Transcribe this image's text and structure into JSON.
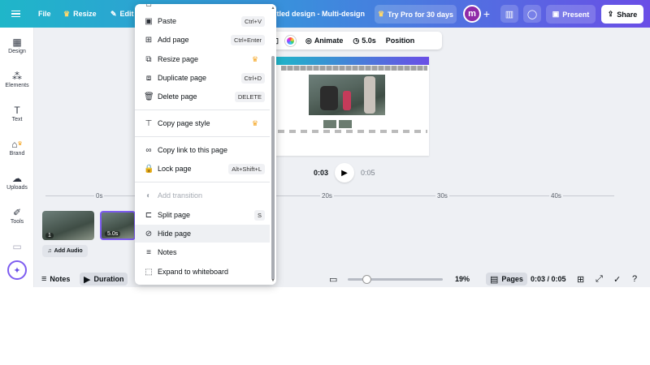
{
  "topbar": {
    "file": "File",
    "resize": "Resize",
    "edit": "Edit",
    "doc_title": "itled design - Multi-design",
    "try_pro": "Try Pro for 30 days",
    "avatar_letter": "m",
    "plus": "+",
    "present": "Present",
    "share": "Share"
  },
  "sidebar": {
    "items": [
      {
        "label": "Design",
        "icon": "design-icon"
      },
      {
        "label": "Elements",
        "icon": "elements-icon"
      },
      {
        "label": "Text",
        "icon": "text-icon"
      },
      {
        "label": "Brand",
        "icon": "brand-icon"
      },
      {
        "label": "Uploads",
        "icon": "uploads-icon"
      },
      {
        "label": "Tools",
        "icon": "tools-icon"
      }
    ]
  },
  "canvas_toolbar": {
    "animate": "Animate",
    "duration": "5.0s",
    "position": "Position"
  },
  "playback": {
    "current": "0:03",
    "total": "0:05"
  },
  "timeline": {
    "ticks": [
      "0s",
      "20s",
      "30s",
      "40s"
    ],
    "pages": [
      {
        "badge": "1"
      },
      {
        "badge": "5.0s"
      }
    ],
    "add_audio": "Add Audio"
  },
  "bottombar": {
    "notes": "Notes",
    "duration": "Duration",
    "zoom": "19%",
    "zoom_fraction": 0.19,
    "pages": "Pages",
    "page_count": "0:03 / 0:05"
  },
  "context_menu": {
    "items": [
      {
        "label": "Paste",
        "shortcut": "Ctrl+V",
        "icon": "paste-icon"
      },
      {
        "label": "Add page",
        "shortcut": "Ctrl+Enter",
        "icon": "add-page-icon"
      },
      {
        "label": "Resize page",
        "icon": "resize-page-icon",
        "pro": true
      },
      {
        "label": "Duplicate page",
        "shortcut": "Ctrl+D",
        "icon": "duplicate-page-icon"
      },
      {
        "label": "Delete page",
        "shortcut": "DELETE",
        "icon": "trash-icon"
      },
      {
        "label": "Copy page style",
        "icon": "paint-roller-icon",
        "pro": true
      },
      {
        "label": "Copy link to this page",
        "icon": "link-icon"
      },
      {
        "label": "Lock page",
        "shortcut": "Alt+Shift+L",
        "icon": "lock-icon"
      },
      {
        "label": "Add transition",
        "icon": "transition-icon",
        "disabled": true
      },
      {
        "label": "Split page",
        "shortcut": "S",
        "icon": "split-icon"
      },
      {
        "label": "Hide page",
        "icon": "eye-slash-icon",
        "hovered": true
      },
      {
        "label": "Notes",
        "icon": "notes-icon"
      },
      {
        "label": "Expand to whiteboard",
        "icon": "whiteboard-icon"
      }
    ]
  }
}
